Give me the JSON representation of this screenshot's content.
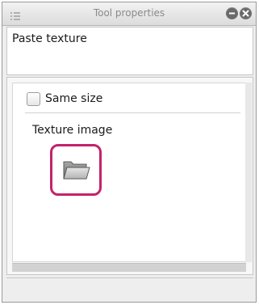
{
  "window": {
    "title": "Tool properties"
  },
  "tool": {
    "name": "Paste texture"
  },
  "options": {
    "same_size": {
      "label": "Same size",
      "checked": false
    },
    "texture_image": {
      "label": "Texture image",
      "button_icon": "folder-icon",
      "highlight_color": "#c4226c"
    }
  },
  "icons": {
    "minimize": "minimize-icon",
    "close": "close-icon",
    "grip": "menu-grip-icon"
  }
}
